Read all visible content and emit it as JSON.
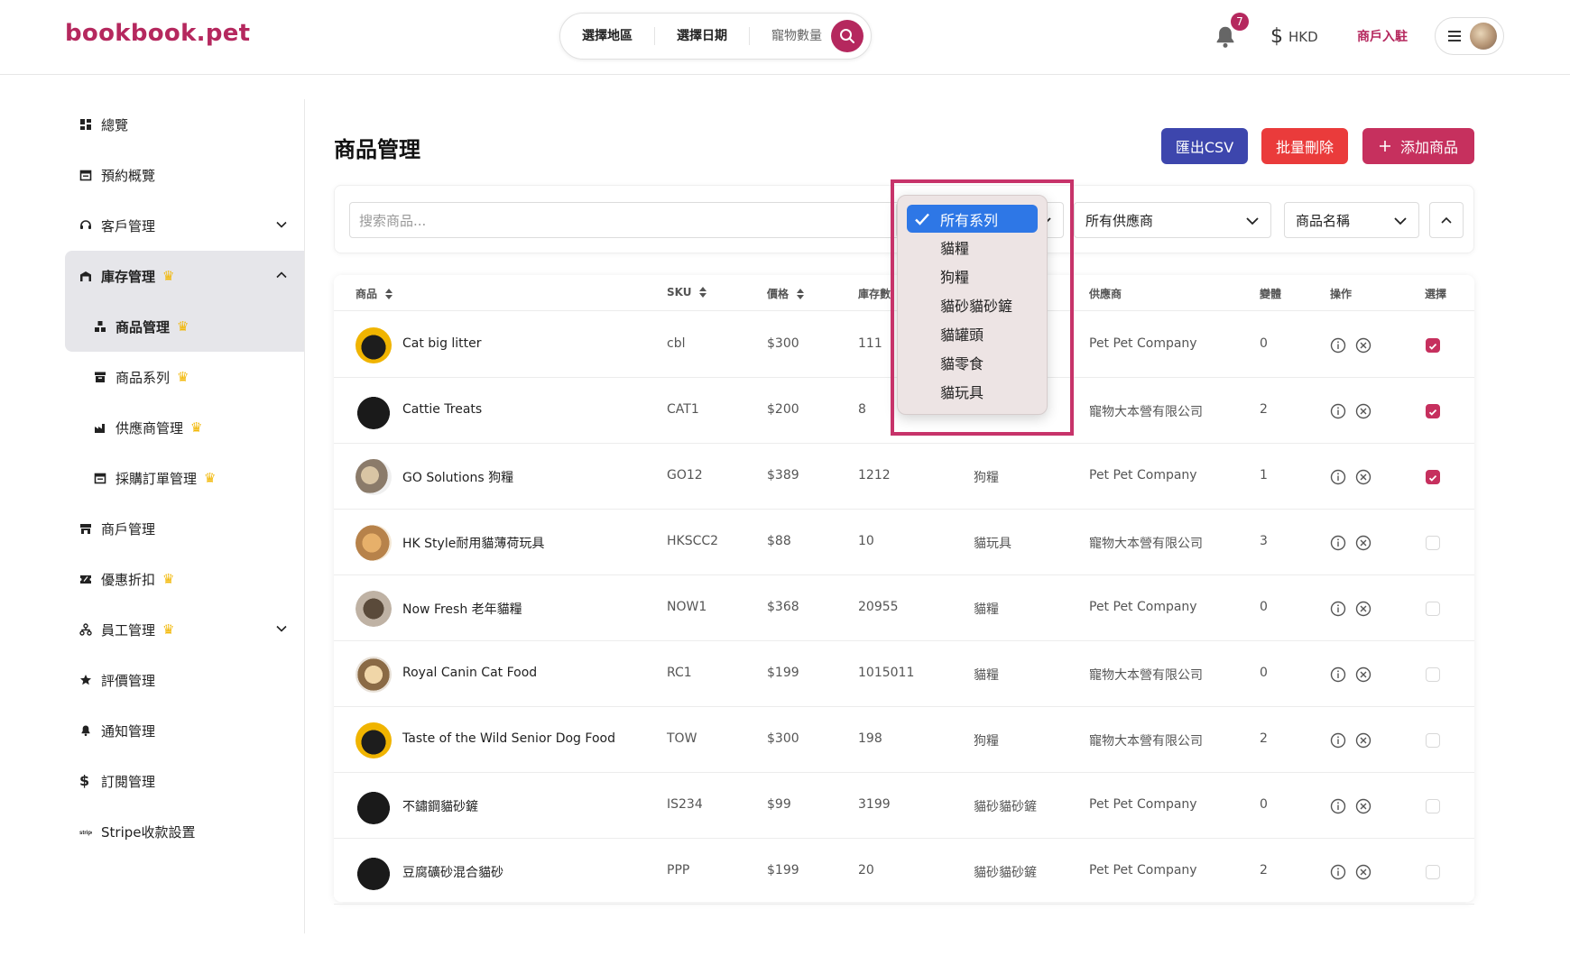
{
  "header": {
    "logo": "bookbook.pet",
    "search": {
      "region": "選擇地區",
      "date": "選擇日期",
      "pets": "寵物數量"
    },
    "notification_count": "7",
    "currency": "HKD",
    "merchant_link": "商戶入駐"
  },
  "sidebar": {
    "items": [
      {
        "label": "總覽"
      },
      {
        "label": "預約概覽"
      },
      {
        "label": "客戶管理"
      },
      {
        "label": "庫存管理"
      },
      {
        "label": "商品管理"
      },
      {
        "label": "商品系列"
      },
      {
        "label": "供應商管理"
      },
      {
        "label": "採購訂單管理"
      },
      {
        "label": "商戶管理"
      },
      {
        "label": "優惠折扣"
      },
      {
        "label": "員工管理"
      },
      {
        "label": "評價管理"
      },
      {
        "label": "通知管理"
      },
      {
        "label": "訂閱管理"
      },
      {
        "label": "Stripe收款設置"
      }
    ]
  },
  "main": {
    "title": "商品管理",
    "buttons": {
      "export": "匯出CSV",
      "bulk_delete": "批量刪除",
      "add": "添加商品"
    }
  },
  "filters": {
    "search_placeholder": "搜索商品...",
    "vendor": "所有供應商",
    "sort": "商品名稱"
  },
  "series_dropdown": {
    "options": [
      "所有系列",
      "貓糧",
      "狗糧",
      "貓砂貓砂鏟",
      "貓罐頭",
      "貓零食",
      "貓玩具"
    ],
    "selected": "所有系列"
  },
  "table": {
    "headers": {
      "product": "商品",
      "sku": "SKU",
      "price": "價格",
      "stock": "庫存數",
      "vendor": "供應商",
      "variants": "變體",
      "actions": "操作",
      "select": "選擇"
    },
    "rows": [
      {
        "name": "Cat big litter",
        "sku": "cbl",
        "price": "$300",
        "stock": "111",
        "series": "",
        "vendor": "Pet Pet Company",
        "variants": "0",
        "selected": true
      },
      {
        "name": "Cattie Treats",
        "sku": "CAT1",
        "price": "$200",
        "stock": "8",
        "series": "",
        "vendor": "寵物大本營有限公司",
        "variants": "2",
        "selected": true
      },
      {
        "name": "GO Solutions 狗糧",
        "sku": "GO12",
        "price": "$389",
        "stock": "1212",
        "series": "狗糧",
        "vendor": "Pet Pet Company",
        "variants": "1",
        "selected": true
      },
      {
        "name": "HK Style耐用貓薄荷玩具",
        "sku": "HKSCC2",
        "price": "$88",
        "stock": "10",
        "series": "貓玩具",
        "vendor": "寵物大本營有限公司",
        "variants": "3",
        "selected": false
      },
      {
        "name": "Now Fresh 老年貓糧",
        "sku": "NOW1",
        "price": "$368",
        "stock": "20955",
        "series": "貓糧",
        "vendor": "Pet Pet Company",
        "variants": "0",
        "selected": false
      },
      {
        "name": "Royal Canin Cat Food",
        "sku": "RC1",
        "price": "$199",
        "stock": "1015011",
        "series": "貓糧",
        "vendor": "寵物大本營有限公司",
        "variants": "0",
        "selected": false
      },
      {
        "name": "Taste of the Wild Senior Dog Food",
        "sku": "TOW",
        "price": "$300",
        "stock": "198",
        "series": "狗糧",
        "vendor": "寵物大本營有限公司",
        "variants": "2",
        "selected": false
      },
      {
        "name": "不鏽鋼貓砂鏟",
        "sku": "IS234",
        "price": "$99",
        "stock": "3199",
        "series": "貓砂貓砂鏟",
        "vendor": "Pet Pet Company",
        "variants": "0",
        "selected": false
      },
      {
        "name": "豆腐礦砂混合貓砂",
        "sku": "PPP",
        "price": "$199",
        "stock": "20",
        "series": "貓砂貓砂鏟",
        "vendor": "Pet Pet Company",
        "variants": "2",
        "selected": false
      }
    ]
  }
}
